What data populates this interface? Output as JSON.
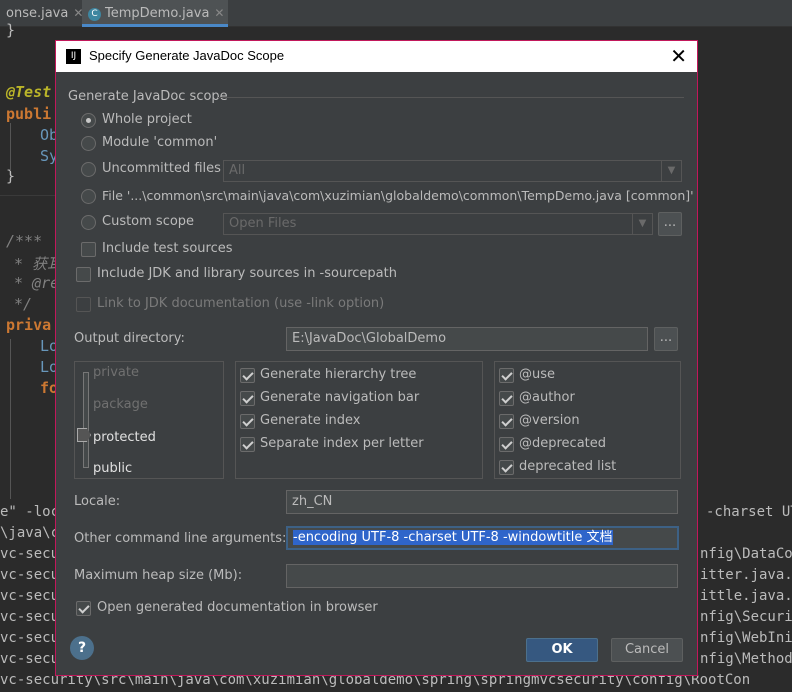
{
  "ide": {
    "tabs": [
      {
        "label": "onse.java"
      },
      {
        "label": "TempDemo.java"
      }
    ],
    "code_lines": [
      {
        "text": "}",
        "color": "#bbbbbb"
      },
      {
        "text": "@Test",
        "color": "#bbb529"
      },
      {
        "text": "publi",
        "color": "#cc7832"
      },
      {
        "text": "Ob",
        "color": "#6897bb"
      },
      {
        "text": "Sy",
        "color": "#6897bb"
      },
      {
        "text": "}",
        "color": "#bbbbbb"
      },
      {
        "text": "/***",
        "color": "#808080"
      },
      {
        "text": "* 获耳",
        "color": "#808080"
      },
      {
        "text": "* @re",
        "color": "#808080"
      },
      {
        "text": "*/",
        "color": "#808080"
      },
      {
        "text": "priva",
        "color": "#cc7832"
      },
      {
        "text": "Lo",
        "color": "#6897bb"
      },
      {
        "text": "Lo",
        "color": "#6897bb"
      },
      {
        "text": "fo",
        "color": "#cc7832"
      }
    ],
    "terminal_lines": [
      {
        "left": "e\" -loc",
        "right": "-charset UT"
      },
      {
        "left": "\\java\\c",
        "right": ""
      },
      {
        "left": "vc-secur",
        "right": "nfig\\DataCo"
      },
      {
        "left": "vc-secur",
        "right": "itter.java."
      },
      {
        "left": "vc-secur",
        "right": "ittle.java."
      },
      {
        "left": "vc-secur",
        "right": "nfig\\Securi"
      },
      {
        "left": "vc-secur",
        "right": "nfig\\WebIni"
      },
      {
        "left": "vc-secur",
        "right": "nfig\\Method"
      },
      {
        "left": "vc-security\\src\\main\\java\\com\\xuzimian\\globaldemo\\spring\\springmvcsecurity\\config\\RootCon",
        "right": ""
      }
    ]
  },
  "dialog": {
    "title": "Specify Generate JavaDoc Scope",
    "scope_group_label": "Generate JavaDoc scope",
    "scope_options": {
      "whole_project": "Whole project",
      "module": "Module 'common'",
      "uncommitted": "Uncommitted files",
      "file": "File '...\\common\\src\\main\\java\\com\\xuzimian\\globaldemo\\common\\TempDemo.java [common]'",
      "custom": "Custom scope"
    },
    "selected_scope": "whole_project",
    "uncommitted_combo_value": "All",
    "custom_combo_value": "Open Files",
    "browse_label": "...",
    "include_test_sources": "Include test sources",
    "include_jdk": "Include JDK and library sources in -sourcepath",
    "link_jdk": "Link to JDK documentation (use -link option)",
    "output_dir_label": "Output directory:",
    "output_dir_value": "E:\\JavaDoc\\GlobalDemo",
    "visibility_levels": [
      "private",
      "package",
      "protected",
      "public"
    ],
    "visibility_selected": "protected",
    "generate_options": [
      {
        "label": "Generate hierarchy tree",
        "checked": true
      },
      {
        "label": "Generate navigation bar",
        "checked": true
      },
      {
        "label": "Generate index",
        "checked": true
      },
      {
        "label": "Separate index per letter",
        "checked": true
      }
    ],
    "tag_options": [
      {
        "label": "@use",
        "checked": true
      },
      {
        "label": "@author",
        "checked": true
      },
      {
        "label": "@version",
        "checked": true
      },
      {
        "label": "@deprecated",
        "checked": true
      },
      {
        "label": "deprecated list",
        "checked": true
      }
    ],
    "locale_label": "Locale:",
    "locale_value": "zh_CN",
    "other_args_label": "Other command line arguments:",
    "other_args_value": "-encoding UTF-8 -charset UTF-8 -windowtitle 文档",
    "max_heap_label": "Maximum heap size (Mb):",
    "max_heap_value": "",
    "open_browser_label": "Open generated documentation in browser",
    "help_label": "?",
    "ok_label": "OK",
    "cancel_label": "Cancel"
  }
}
